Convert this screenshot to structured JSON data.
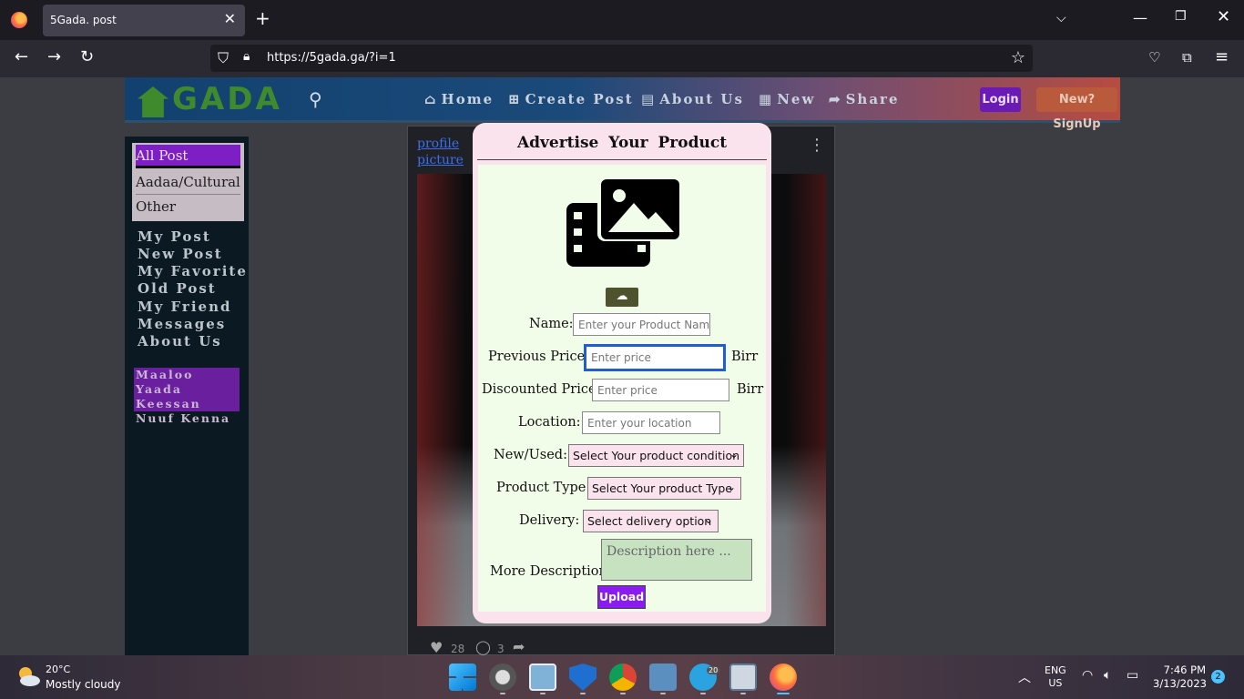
{
  "browser": {
    "tab_title": "5Gada. post",
    "tab_close": "✕",
    "new_tab": "+",
    "url": "https://5gada.ga/?i=1",
    "window_min": "—",
    "window_max": "❐",
    "window_close": "✕"
  },
  "site": {
    "logo_text": "GADA",
    "menu": [
      {
        "label": "Home",
        "icon": "home-icon"
      },
      {
        "label": "Create Post",
        "icon": "plus-square-icon"
      },
      {
        "label": "About Us",
        "icon": "id-card-icon"
      },
      {
        "label": "New",
        "icon": "newspaper-icon"
      },
      {
        "label": "Share",
        "icon": "share-icon"
      }
    ],
    "login_label": "Login",
    "signup_label": "New? SignUp"
  },
  "sidebar": {
    "categories": [
      "All Post",
      "Aadaa/Cultural",
      "Other"
    ],
    "links": [
      "My Post",
      "New Post",
      "My Favorite",
      "Old Post",
      "My Friend",
      "Messages",
      "About Us"
    ],
    "promo": "Maaloo Yaada Keessan Nuuf Kenna"
  },
  "post": {
    "profile_alt": "profile picture",
    "likes": "28",
    "comments": "3"
  },
  "modal": {
    "title": "Advertise Your Product",
    "fields": {
      "name_label": "Name:",
      "name_placeholder": "Enter your Product Name",
      "prev_price_label": "Previous Price:",
      "prev_price_placeholder": "Enter price",
      "prev_price_unit": "Birr",
      "disc_price_label": "Discounted Price:",
      "disc_price_placeholder": "Enter price",
      "disc_price_unit": "Birr",
      "location_label": "Location:",
      "location_placeholder": "Enter your location",
      "condition_label": "New/Used:",
      "condition_value": "Select Your product condition",
      "type_label": "Product Type:",
      "type_value": "Select Your product Type",
      "delivery_label": "Delivery:",
      "delivery_value": "Select delivery option",
      "desc_label": "More Description:",
      "desc_placeholder": "Description here ..."
    },
    "upload_label": "Upload"
  },
  "taskbar": {
    "weather_temp": "20°C",
    "weather_desc": "Mostly cloudy",
    "lang_line1": "ENG",
    "lang_line2": "US",
    "time": "7:46 PM",
    "date": "3/13/2023",
    "notifications": "2",
    "telegram_badge": "20"
  },
  "colors": {
    "accent_purple": "#8a1cf0",
    "modal_bg": "#fbe3ee",
    "form_bg": "#f1fde9"
  }
}
